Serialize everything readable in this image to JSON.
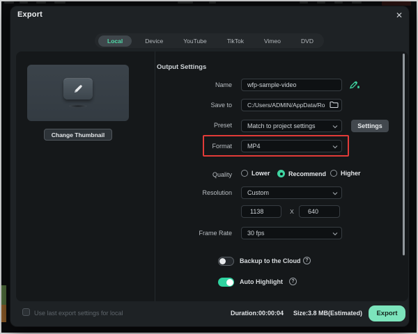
{
  "window": {
    "title": "Export",
    "close_glyph": "✕"
  },
  "tabs": {
    "items": [
      {
        "label": "Local",
        "active": true
      },
      {
        "label": "Device",
        "active": false
      },
      {
        "label": "YouTube",
        "active": false
      },
      {
        "label": "TikTok",
        "active": false
      },
      {
        "label": "Vimeo",
        "active": false
      },
      {
        "label": "DVD",
        "active": false
      }
    ]
  },
  "thumbnail": {
    "change_button_label": "Change Thumbnail"
  },
  "output_settings": {
    "heading": "Output Settings",
    "name": {
      "label": "Name",
      "value": "wfp-sample-video"
    },
    "save_to": {
      "label": "Save to",
      "value": "C:/Users/ADMIN/AppData/Ro"
    },
    "preset": {
      "label": "Preset",
      "value": "Match to project settings",
      "settings_button_label": "Settings"
    },
    "format": {
      "label": "Format",
      "value": "MP4",
      "highlighted": true,
      "highlight_color": "#e23b38"
    },
    "quality": {
      "label": "Quality",
      "options": [
        "Lower",
        "Recommend",
        "Higher"
      ],
      "selected": "Recommend"
    },
    "resolution": {
      "label": "Resolution",
      "value": "Custom",
      "width_value": "1138",
      "separator": "X",
      "height_value": "640"
    },
    "frame_rate": {
      "label": "Frame Rate",
      "value": "30 fps"
    },
    "backup_cloud": {
      "label": "Backup to the Cloud",
      "enabled": false
    },
    "auto_highlight": {
      "label": "Auto Highlight",
      "enabled": true
    },
    "help_glyph": "?"
  },
  "footer": {
    "checkbox_label": "Use last export settings for local",
    "checked": false,
    "duration": "Duration:00:00:04",
    "size": "Size:3.8 MB(Estimated)",
    "export_button_label": "Export"
  },
  "colors": {
    "accent_teal": "#4fd8a7",
    "export_button": "#7ce4bc",
    "highlight_red": "#e23b38"
  }
}
